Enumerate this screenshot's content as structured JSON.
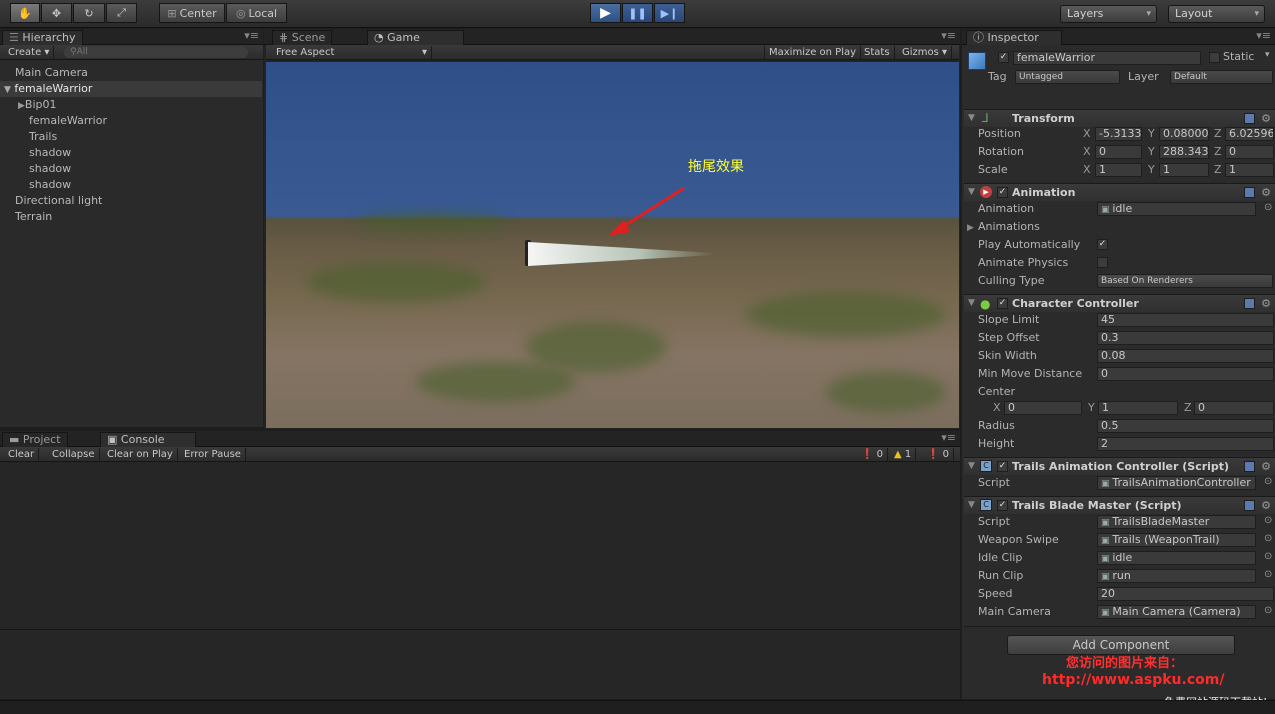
{
  "toolbar": {
    "tools": [
      "hand-icon",
      "move-icon",
      "rotate-icon",
      "scale-icon"
    ],
    "pivot": "Center",
    "space": "Local",
    "layers": "Layers",
    "layout": "Layout"
  },
  "hierarchy": {
    "tab": "Hierarchy",
    "create": "Create",
    "search_placeholder": "All",
    "items": [
      {
        "label": "Main Camera"
      },
      {
        "label": "femaleWarrior"
      },
      {
        "label": "Bip01"
      },
      {
        "label": "femaleWarrior"
      },
      {
        "label": "Trails"
      },
      {
        "label": "shadow"
      },
      {
        "label": "shadow"
      },
      {
        "label": "shadow"
      },
      {
        "label": "Directional light"
      },
      {
        "label": "Terrain"
      }
    ]
  },
  "game": {
    "tabs": [
      "Scene",
      "Game"
    ],
    "aspect": "Free Aspect",
    "maximize": "Maximize on Play",
    "stats": "Stats",
    "gizmos": "Gizmos",
    "annotation": "拖尾效果"
  },
  "bottom": {
    "tabs": [
      "Project",
      "Console"
    ],
    "buttons": [
      "Clear",
      "Collapse",
      "Clear on Play",
      "Error Pause"
    ],
    "counts": {
      "info": "0",
      "warn": "1",
      "error": "0"
    }
  },
  "inspector": {
    "tab": "Inspector",
    "object_name": "femaleWarrior",
    "static": "Static",
    "tag_label": "Tag",
    "tag": "Untagged",
    "layer_label": "Layer",
    "layer": "Default",
    "transform": {
      "title": "Transform",
      "position_label": "Position",
      "position": [
        "-5.3133",
        "0.08000",
        "6.02596"
      ],
      "rotation_label": "Rotation",
      "rotation": [
        "0",
        "288.343",
        "0"
      ],
      "scale_label": "Scale",
      "scale": [
        "1",
        "1",
        "1"
      ]
    },
    "animation": {
      "title": "Animation",
      "animation_label": "Animation",
      "animation": "idle",
      "animations_label": "Animations",
      "play_auto_label": "Play Automatically",
      "animate_physics_label": "Animate Physics",
      "culling_label": "Culling Type",
      "culling": "Based On Renderers"
    },
    "character_controller": {
      "title": "Character Controller",
      "slope_label": "Slope Limit",
      "slope": "45",
      "step_label": "Step Offset",
      "step": "0.3",
      "skin_label": "Skin Width",
      "skin": "0.08",
      "minmove_label": "Min Move Distance",
      "minmove": "0",
      "center_label": "Center",
      "center": [
        "0",
        "1",
        "0"
      ],
      "radius_label": "Radius",
      "radius": "0.5",
      "height_label": "Height",
      "height": "2"
    },
    "trails_anim": {
      "title": "Trails Animation Controller (Script)",
      "script_label": "Script",
      "script": "TrailsAnimationController"
    },
    "trails_blade": {
      "title": "Trails Blade Master (Script)",
      "script_label": "Script",
      "script": "TrailsBladeMaster",
      "weapon_label": "Weapon Swipe",
      "weapon": "Trails (WeaponTrail)",
      "idle_label": "Idle Clip",
      "idle": "idle",
      "run_label": "Run Clip",
      "run": "run",
      "speed_label": "Speed",
      "speed": "20",
      "camera_label": "Main Camera",
      "camera": "Main Camera (Camera)"
    },
    "add_component": "Add Component"
  },
  "watermark": {
    "line1": "您访问的图片来自：",
    "line2": "http://www.aspku.com/",
    "line3": "免费网站源码下载站!"
  }
}
